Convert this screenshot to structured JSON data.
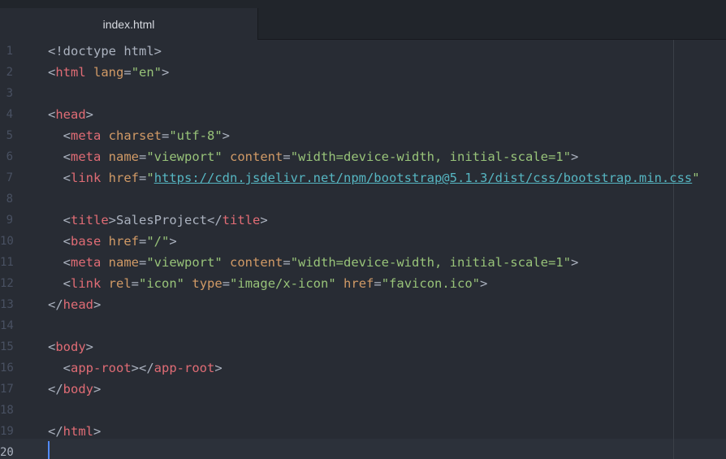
{
  "tab": {
    "title": "index.html"
  },
  "editor": {
    "active_line": 20,
    "lines": [
      {
        "n": "1",
        "tokens": [
          {
            "t": "punct",
            "v": "<!doctype html>"
          }
        ]
      },
      {
        "n": "2",
        "tokens": [
          {
            "t": "punct",
            "v": "<"
          },
          {
            "t": "tag",
            "v": "html"
          },
          {
            "t": "punct",
            "v": " "
          },
          {
            "t": "attr",
            "v": "lang"
          },
          {
            "t": "punct",
            "v": "="
          },
          {
            "t": "str",
            "v": "\"en\""
          },
          {
            "t": "punct",
            "v": ">"
          }
        ]
      },
      {
        "n": "3",
        "tokens": []
      },
      {
        "n": "4",
        "tokens": [
          {
            "t": "punct",
            "v": "<"
          },
          {
            "t": "tag",
            "v": "head"
          },
          {
            "t": "punct",
            "v": ">"
          }
        ]
      },
      {
        "n": "5",
        "tokens": [
          {
            "t": "punct",
            "v": "  <"
          },
          {
            "t": "tag",
            "v": "meta"
          },
          {
            "t": "punct",
            "v": " "
          },
          {
            "t": "attr",
            "v": "charset"
          },
          {
            "t": "punct",
            "v": "="
          },
          {
            "t": "str",
            "v": "\"utf-8\""
          },
          {
            "t": "punct",
            "v": ">"
          }
        ]
      },
      {
        "n": "6",
        "tokens": [
          {
            "t": "punct",
            "v": "  <"
          },
          {
            "t": "tag",
            "v": "meta"
          },
          {
            "t": "punct",
            "v": " "
          },
          {
            "t": "attr",
            "v": "name"
          },
          {
            "t": "punct",
            "v": "="
          },
          {
            "t": "str",
            "v": "\"viewport\""
          },
          {
            "t": "punct",
            "v": " "
          },
          {
            "t": "attr",
            "v": "content"
          },
          {
            "t": "punct",
            "v": "="
          },
          {
            "t": "str",
            "v": "\"width=device-width, initial-scale=1\""
          },
          {
            "t": "punct",
            "v": ">"
          }
        ]
      },
      {
        "n": "7",
        "tokens": [
          {
            "t": "punct",
            "v": "  <"
          },
          {
            "t": "tag",
            "v": "link"
          },
          {
            "t": "punct",
            "v": " "
          },
          {
            "t": "attr",
            "v": "href"
          },
          {
            "t": "punct",
            "v": "="
          },
          {
            "t": "str",
            "v": "\""
          },
          {
            "t": "link",
            "v": "https://cdn.jsdelivr.net/npm/bootstrap@5.1.3/dist/css/bootstrap.min.css"
          },
          {
            "t": "str",
            "v": "\""
          }
        ]
      },
      {
        "n": "8",
        "tokens": []
      },
      {
        "n": "9",
        "tokens": [
          {
            "t": "punct",
            "v": "  <"
          },
          {
            "t": "tag",
            "v": "title"
          },
          {
            "t": "punct",
            "v": ">SalesProject</"
          },
          {
            "t": "tag",
            "v": "title"
          },
          {
            "t": "punct",
            "v": ">"
          }
        ]
      },
      {
        "n": "10",
        "tokens": [
          {
            "t": "punct",
            "v": "  <"
          },
          {
            "t": "tag",
            "v": "base"
          },
          {
            "t": "punct",
            "v": " "
          },
          {
            "t": "attr",
            "v": "href"
          },
          {
            "t": "punct",
            "v": "="
          },
          {
            "t": "str",
            "v": "\"/\""
          },
          {
            "t": "punct",
            "v": ">"
          }
        ]
      },
      {
        "n": "11",
        "tokens": [
          {
            "t": "punct",
            "v": "  <"
          },
          {
            "t": "tag",
            "v": "meta"
          },
          {
            "t": "punct",
            "v": " "
          },
          {
            "t": "attr",
            "v": "name"
          },
          {
            "t": "punct",
            "v": "="
          },
          {
            "t": "str",
            "v": "\"viewport\""
          },
          {
            "t": "punct",
            "v": " "
          },
          {
            "t": "attr",
            "v": "content"
          },
          {
            "t": "punct",
            "v": "="
          },
          {
            "t": "str",
            "v": "\"width=device-width, initial-scale=1\""
          },
          {
            "t": "punct",
            "v": ">"
          }
        ]
      },
      {
        "n": "12",
        "tokens": [
          {
            "t": "punct",
            "v": "  <"
          },
          {
            "t": "tag",
            "v": "link"
          },
          {
            "t": "punct",
            "v": " "
          },
          {
            "t": "attr",
            "v": "rel"
          },
          {
            "t": "punct",
            "v": "="
          },
          {
            "t": "str",
            "v": "\"icon\""
          },
          {
            "t": "punct",
            "v": " "
          },
          {
            "t": "attr",
            "v": "type"
          },
          {
            "t": "punct",
            "v": "="
          },
          {
            "t": "str",
            "v": "\"image/x-icon\""
          },
          {
            "t": "punct",
            "v": " "
          },
          {
            "t": "attr",
            "v": "href"
          },
          {
            "t": "punct",
            "v": "="
          },
          {
            "t": "str",
            "v": "\"favicon.ico\""
          },
          {
            "t": "punct",
            "v": ">"
          }
        ]
      },
      {
        "n": "13",
        "tokens": [
          {
            "t": "punct",
            "v": "</"
          },
          {
            "t": "tag",
            "v": "head"
          },
          {
            "t": "punct",
            "v": ">"
          }
        ]
      },
      {
        "n": "14",
        "tokens": []
      },
      {
        "n": "15",
        "tokens": [
          {
            "t": "punct",
            "v": "<"
          },
          {
            "t": "tag",
            "v": "body"
          },
          {
            "t": "punct",
            "v": ">"
          }
        ]
      },
      {
        "n": "16",
        "tokens": [
          {
            "t": "punct",
            "v": "  <"
          },
          {
            "t": "tag",
            "v": "app-root"
          },
          {
            "t": "punct",
            "v": "></"
          },
          {
            "t": "tag",
            "v": "app-root"
          },
          {
            "t": "punct",
            "v": ">"
          }
        ]
      },
      {
        "n": "17",
        "tokens": [
          {
            "t": "punct",
            "v": "</"
          },
          {
            "t": "tag",
            "v": "body"
          },
          {
            "t": "punct",
            "v": ">"
          }
        ]
      },
      {
        "n": "18",
        "tokens": []
      },
      {
        "n": "19",
        "tokens": [
          {
            "t": "punct",
            "v": "</"
          },
          {
            "t": "tag",
            "v": "html"
          },
          {
            "t": "punct",
            "v": ">"
          }
        ]
      },
      {
        "n": "20",
        "tokens": []
      }
    ]
  }
}
